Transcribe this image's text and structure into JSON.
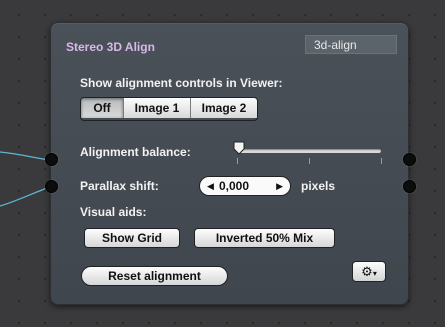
{
  "node": {
    "title": "Stereo 3D Align",
    "name_field": "3d-align",
    "show_controls_label": "Show alignment controls in Viewer:",
    "segments": [
      {
        "label": "Off",
        "selected": true
      },
      {
        "label": "Image 1",
        "selected": false
      },
      {
        "label": "Image 2",
        "selected": false
      }
    ],
    "alignment_balance_label": "Alignment balance:",
    "alignment_balance_value": 0,
    "parallax_label": "Parallax shift:",
    "parallax_value": "0,000",
    "parallax_unit": "pixels",
    "visual_aids_label": "Visual aids:",
    "show_grid_label": "Show Grid",
    "inverted_mix_label": "Inverted 50% Mix",
    "reset_label": "Reset alignment",
    "gear_icon": "gear-icon"
  },
  "colors": {
    "panel_bg": "#454c53",
    "title": "#d7b8e8",
    "wire": "#5fb6d6",
    "canvas": "#3a3a3c"
  }
}
